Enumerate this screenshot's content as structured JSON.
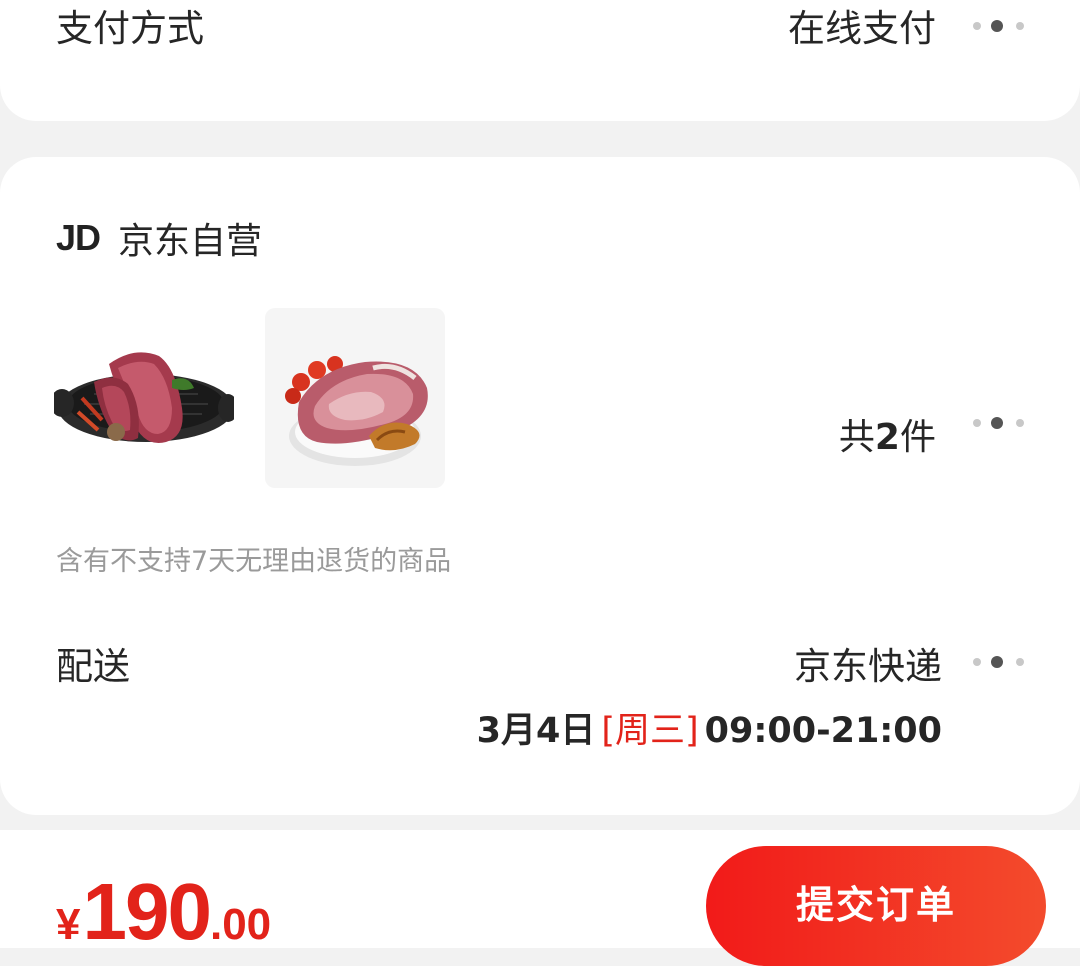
{
  "payment": {
    "label": "支付方式",
    "value": "在线支付",
    "more_icon": "more-dots-icon"
  },
  "shop": {
    "logo_text": "JD",
    "name": "京东自营"
  },
  "products": {
    "thumbnails": [
      {
        "name": "steak-on-grill-pan-image"
      },
      {
        "name": "beef-cut-on-plate-image"
      }
    ],
    "count_prefix": "共",
    "count_number": "2",
    "count_suffix": "件",
    "more_icon": "more-dots-icon"
  },
  "notice": "含有不支持7天无理由退货的商品",
  "delivery": {
    "label": "配送",
    "carrier": "京东快递",
    "date": "3月4日",
    "weekday": "[周三]",
    "time_range": "09:00-21:00",
    "more_icon": "more-dots-icon"
  },
  "footer": {
    "currency": "¥",
    "price_integer": "190",
    "price_decimal": ".00",
    "submit_label": "提交订单"
  },
  "colors": {
    "accent": "#e2231a",
    "background": "#f2f2f2",
    "card": "#ffffff",
    "muted_text": "#9a9a9a"
  }
}
